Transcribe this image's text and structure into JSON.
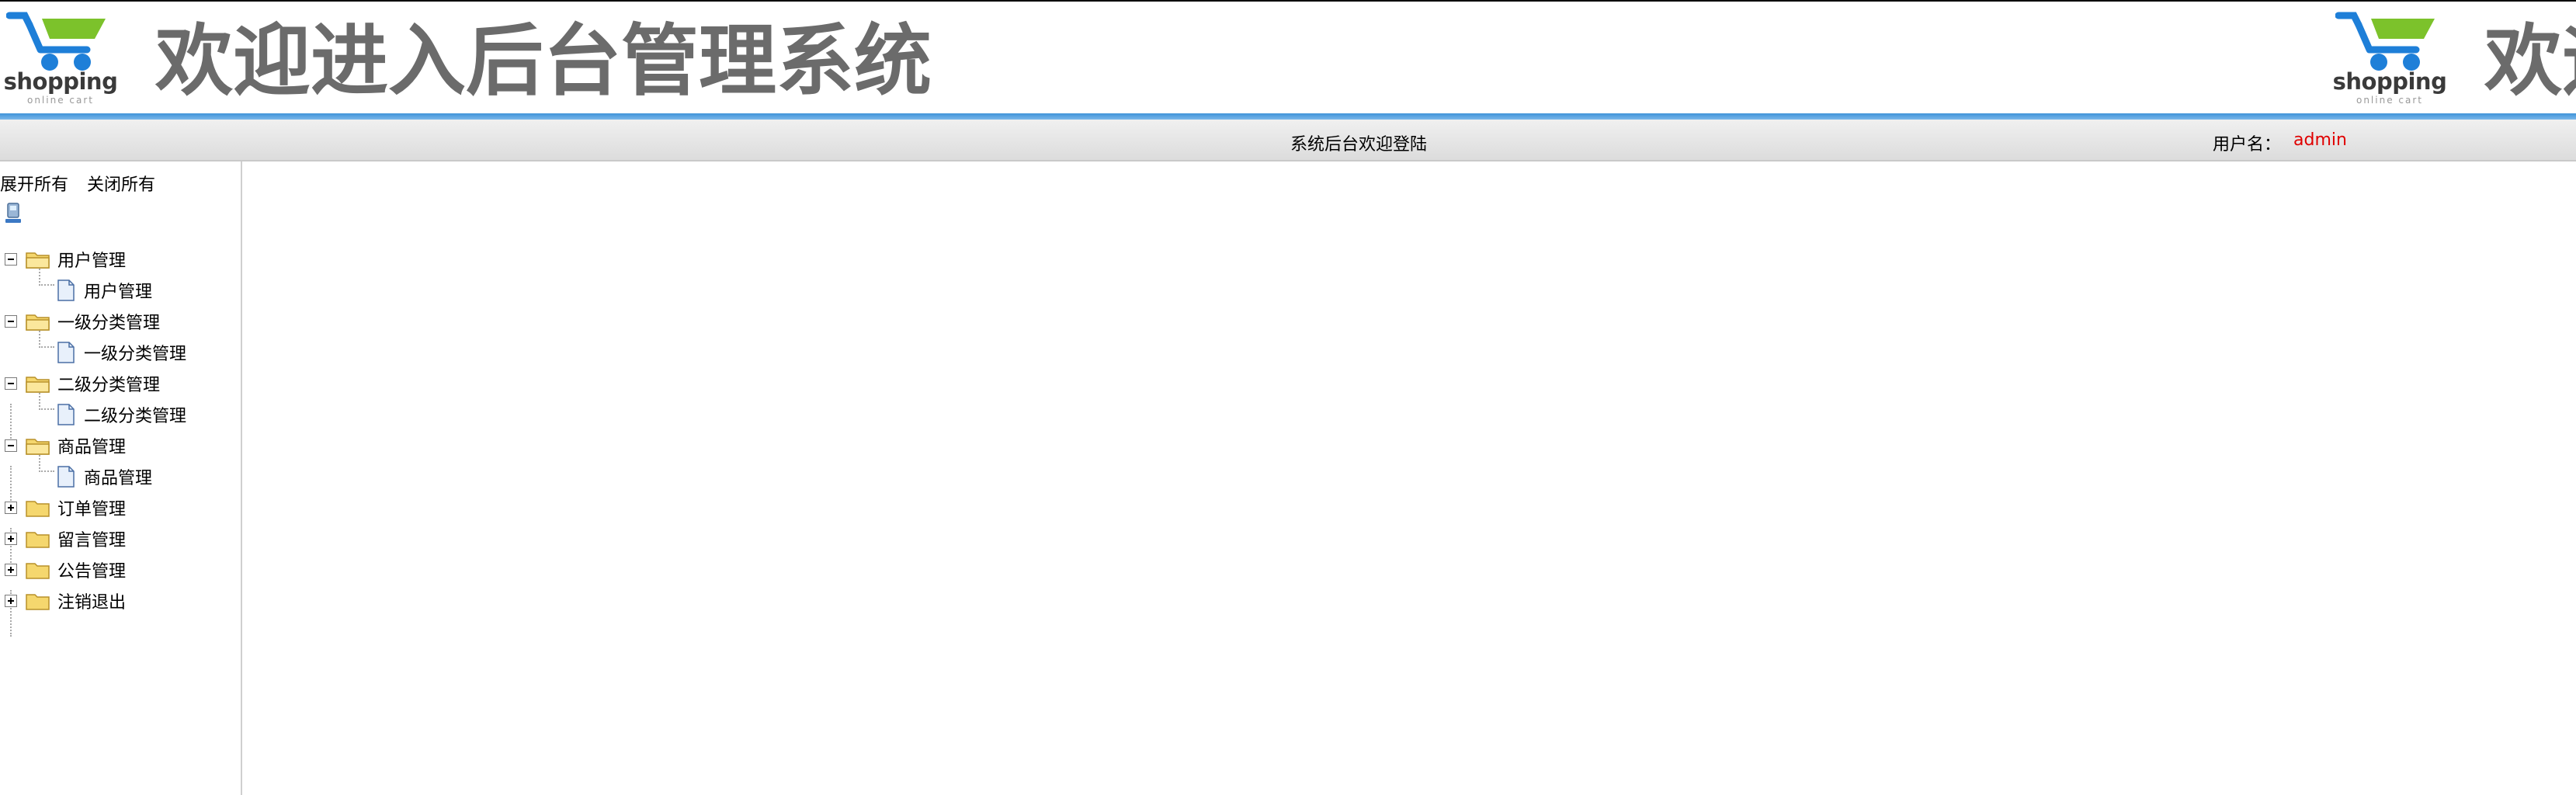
{
  "header": {
    "logo_word": "shopping",
    "logo_sub": "online cart",
    "headline": "欢迎进入后台管理系统"
  },
  "status_bar": {
    "welcome": "系统后台欢迎登陆",
    "user_label": "用户名：",
    "user_name": "admin"
  },
  "tree": {
    "expand_all": "展开所有",
    "collapse_all": "关闭所有",
    "nodes": [
      {
        "label": "用户管理",
        "expanded": true,
        "child": "用户管理"
      },
      {
        "label": "一级分类管理",
        "expanded": true,
        "child": "一级分类管理"
      },
      {
        "label": "二级分类管理",
        "expanded": true,
        "child": "二级分类管理"
      },
      {
        "label": "商品管理",
        "expanded": true,
        "child": "商品管理"
      },
      {
        "label": "订单管理",
        "expanded": false
      },
      {
        "label": "留言管理",
        "expanded": false
      },
      {
        "label": "公告管理",
        "expanded": false
      },
      {
        "label": "注销退出",
        "expanded": false
      }
    ]
  },
  "colors": {
    "accent_blue": "#3f93d9",
    "username_red": "#e00000",
    "headline_gray": "#6b6b6b"
  }
}
